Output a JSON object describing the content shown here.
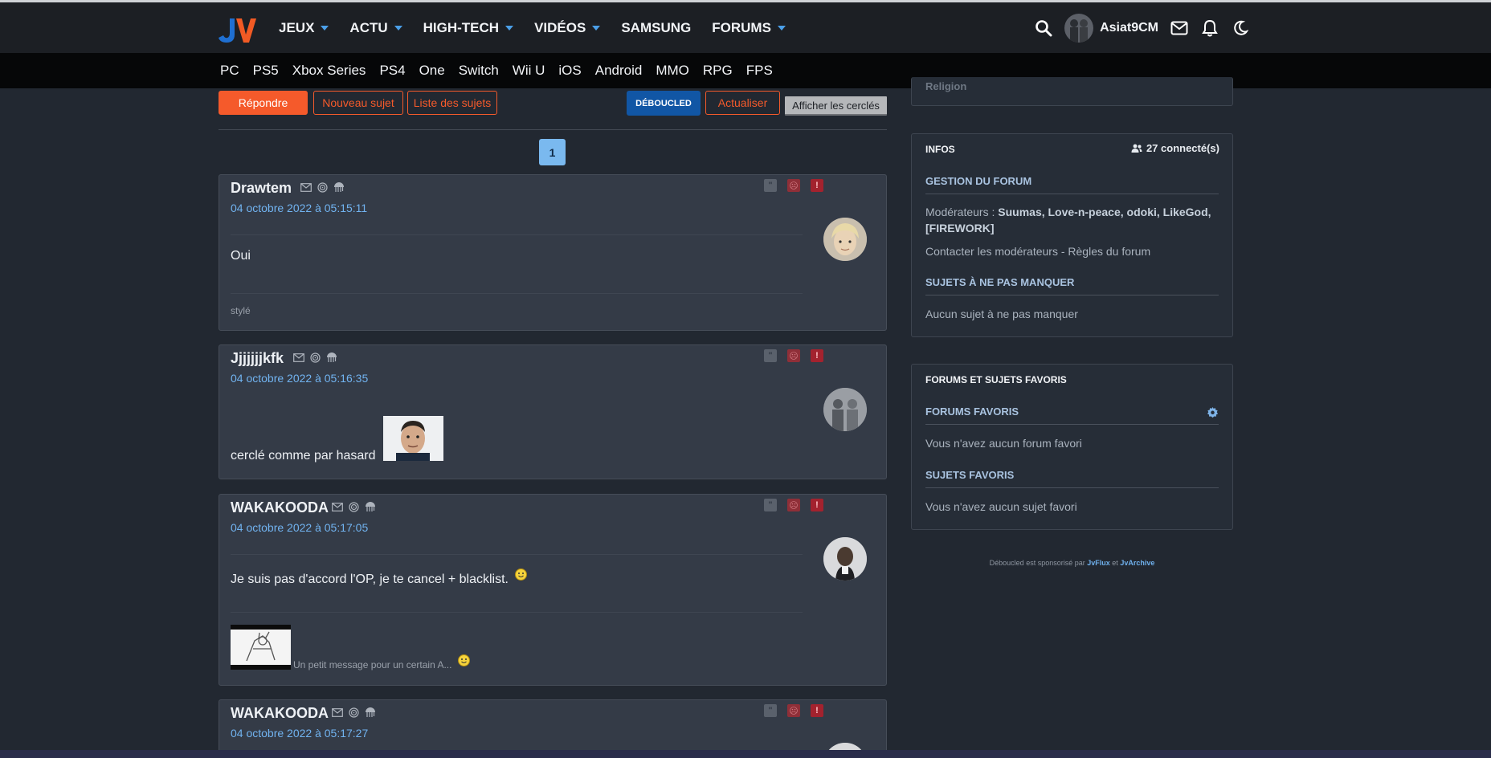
{
  "header": {
    "nav": [
      {
        "label": "JEUX",
        "dropdown": true
      },
      {
        "label": "ACTU",
        "dropdown": true
      },
      {
        "label": "HIGH-TECH",
        "dropdown": true
      },
      {
        "label": "VIDÉOS",
        "dropdown": true
      },
      {
        "label": "SAMSUNG",
        "dropdown": false
      },
      {
        "label": "FORUMS",
        "dropdown": true
      }
    ],
    "username": "Asiat9CM",
    "icons": [
      "search-icon",
      "mail-icon",
      "bell-icon",
      "moon-icon"
    ]
  },
  "platforms": [
    "PC",
    "PS5",
    "Xbox Series",
    "PS4",
    "One",
    "Switch",
    "Wii U",
    "iOS",
    "Android",
    "MMO",
    "RPG",
    "FPS"
  ],
  "actions": {
    "reply": "Répondre",
    "new_topic": "Nouveau sujet",
    "topic_list": "Liste des sujets",
    "deboucled": "DÉBOUCLED",
    "refresh": "Actualiser",
    "show_circled": "Afficher les cerclés"
  },
  "pagination": {
    "current": "1"
  },
  "posts": [
    {
      "author": "Drawtem",
      "date": "04 octobre 2022 à 05:15:11",
      "text": "Oui",
      "signature": "stylé"
    },
    {
      "author": "Jjjjjjjkfk",
      "date": "04 octobre 2022 à 05:16:35",
      "text": "cerclé comme par hasard"
    },
    {
      "author": "WAKAKOODA",
      "date": "04 octobre 2022 à 05:17:05",
      "text": "Je suis pas d'accord l'OP, je te cancel + blacklist.",
      "signature": "Un petit message pour un certain A..."
    },
    {
      "author": "WAKAKOODA",
      "date": "04 octobre 2022 à 05:17:27"
    }
  ],
  "sidebar": {
    "cut_text": "Religion",
    "infos": {
      "title": "INFOS",
      "connected": "27 connecté(s)",
      "management_title": "GESTION DU FORUM",
      "moderators_label": "Modérateurs :",
      "moderators": "Suumas, Love-n-peace, odoki, LikeGod, [FIREWORK]",
      "contact": "Contacter les modérateurs - Règles du forum",
      "must_title": "SUJETS À NE PAS MANQUER",
      "must_text": "Aucun sujet à ne pas manquer"
    },
    "favs": {
      "title": "FORUMS ET SUJETS FAVORIS",
      "forums_title": "FORUMS FAVORIS",
      "forums_text": "Vous n'avez aucun forum favori",
      "topics_title": "SUJETS FAVORIS",
      "topics_text": "Vous n'avez aucun sujet favori"
    },
    "footer": {
      "prefix": "Déboucled est sponsorisé par",
      "link1": "JvFlux",
      "mid": "et",
      "link2": "JvArchive"
    }
  },
  "colors": {
    "accent": "#f55a2b",
    "link": "#71b3f0",
    "deboucled": "#1156a5",
    "page_active": "#7ab9ef"
  }
}
